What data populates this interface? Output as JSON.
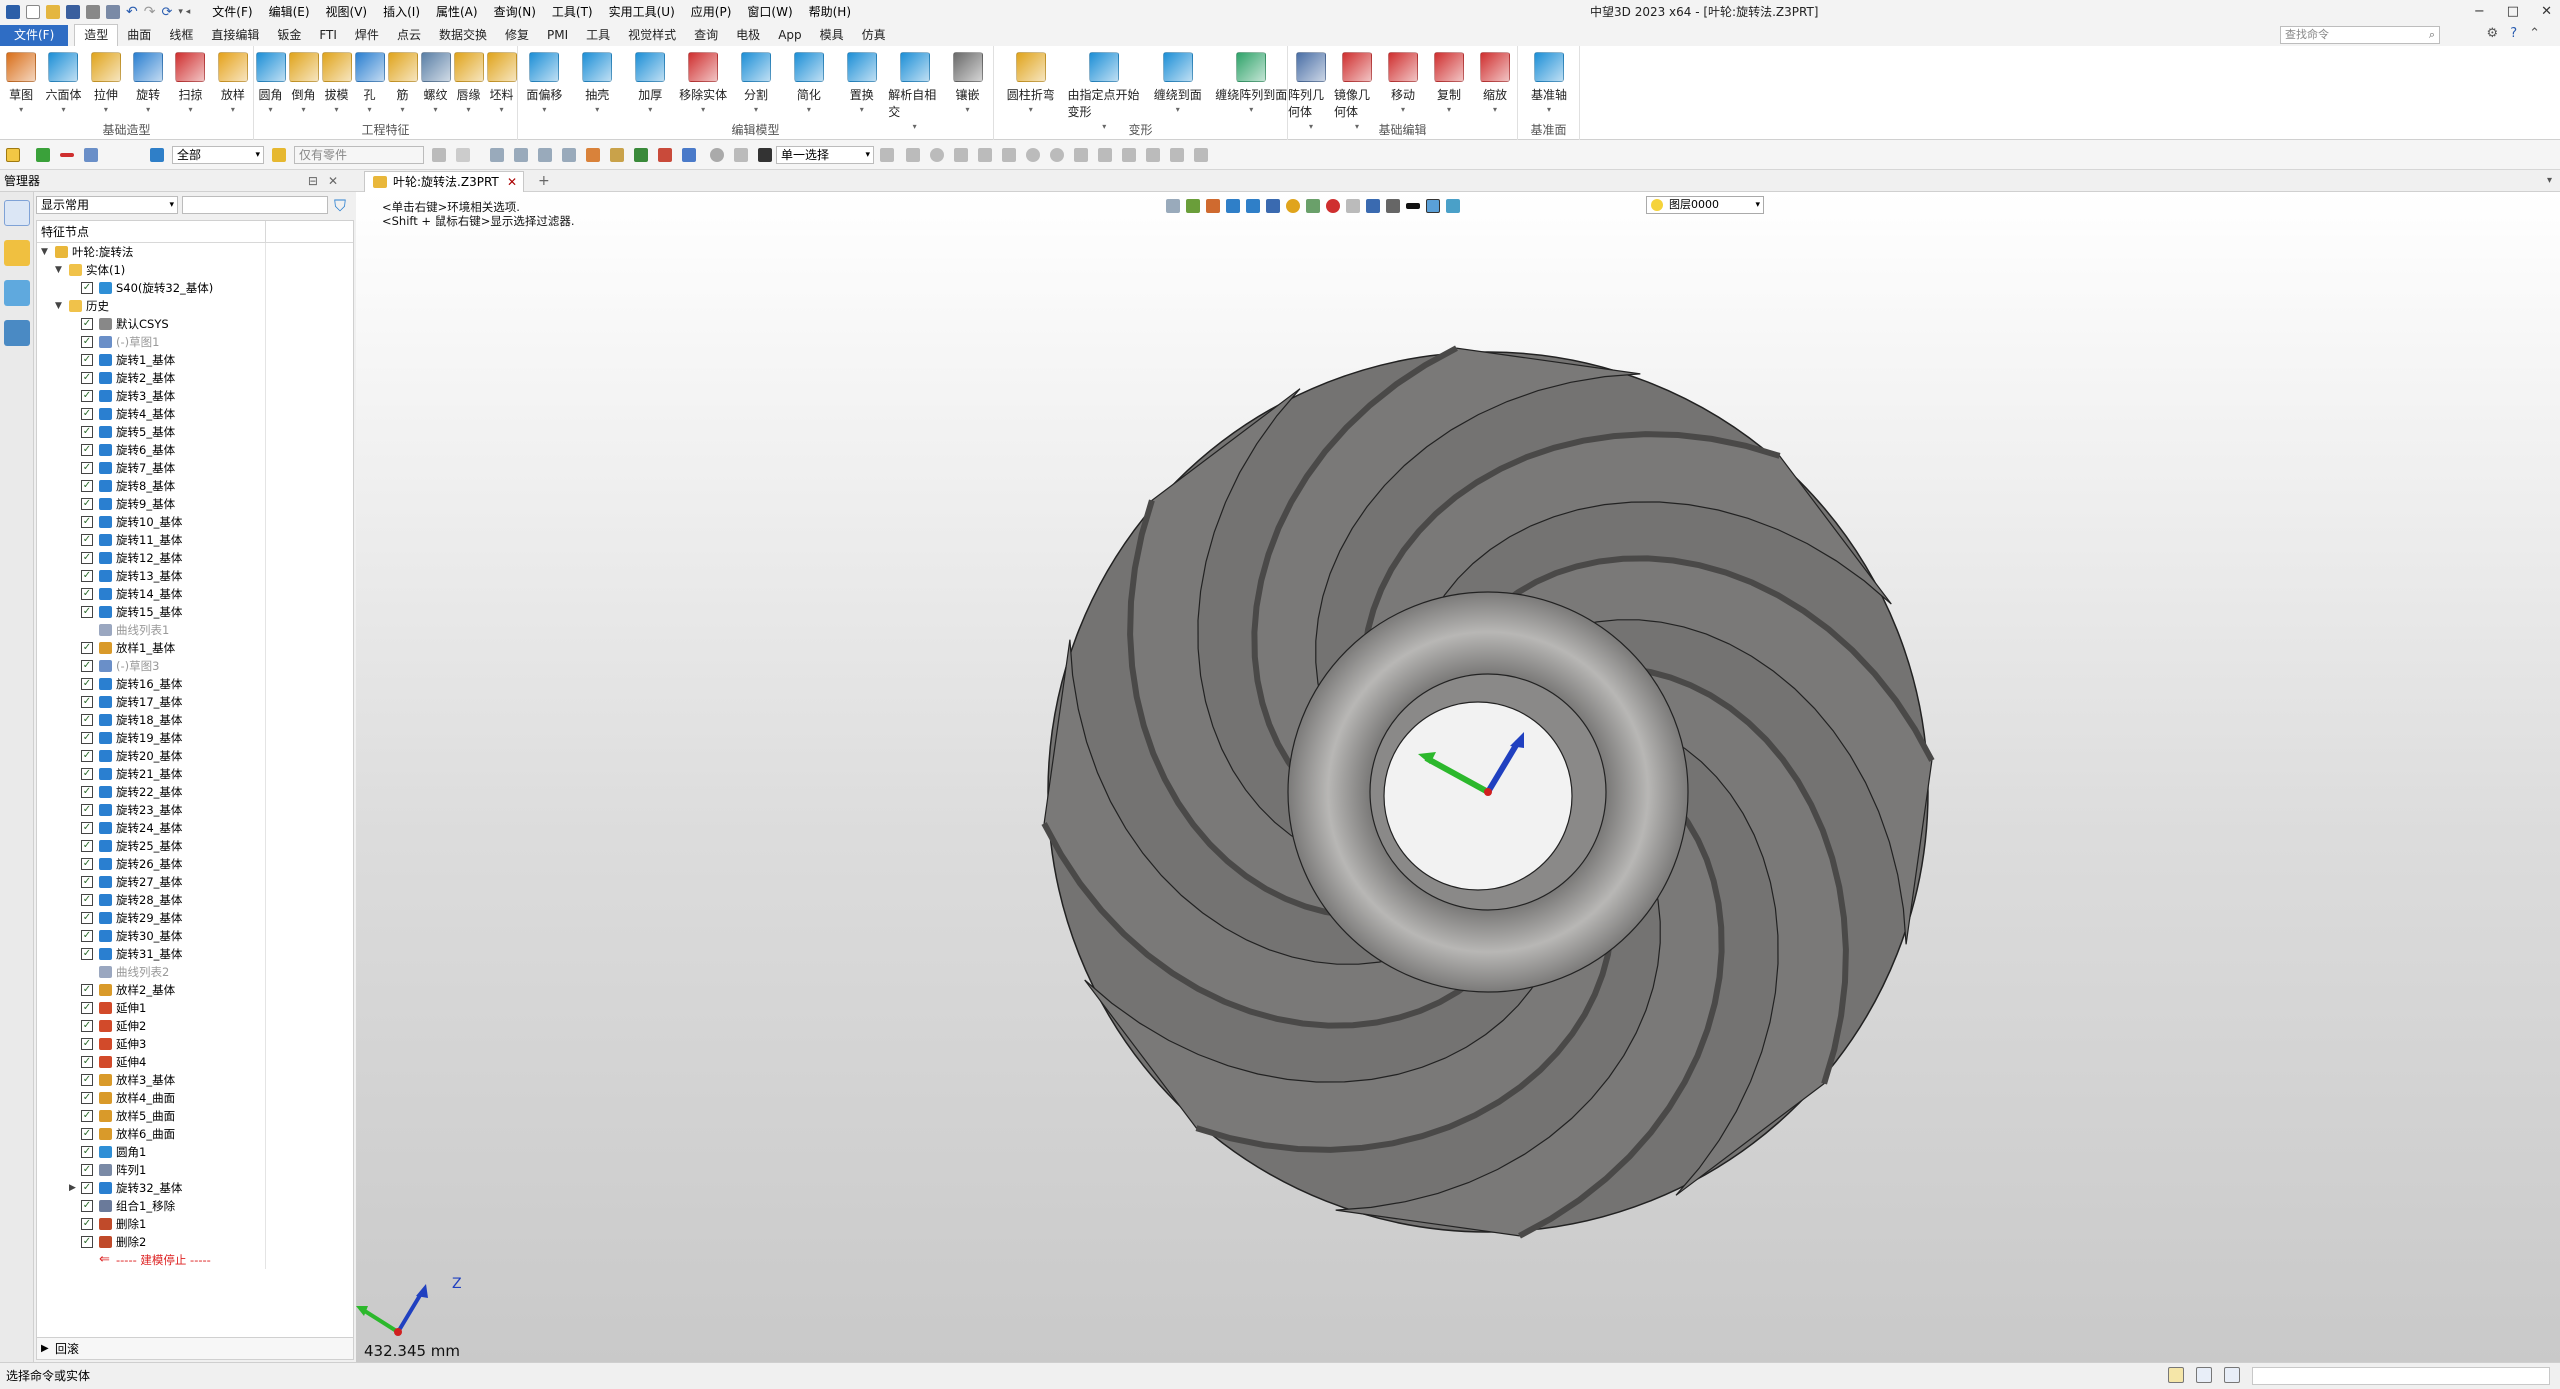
{
  "app": {
    "title": "中望3D 2023 x64 - [叶轮:旋转法.Z3PRT]",
    "menu": [
      "文件(F)",
      "编辑(E)",
      "视图(V)",
      "插入(I)",
      "属性(A)",
      "查询(N)",
      "工具(T)",
      "实用工具(U)",
      "应用(P)",
      "窗口(W)",
      "帮助(H)"
    ],
    "window_controls": [
      "−",
      "□",
      "✕"
    ]
  },
  "ribbon_tabs": [
    "文件(F)",
    "造型",
    "曲面",
    "线框",
    "直接编辑",
    "钣金",
    "FTI",
    "焊件",
    "点云",
    "数据交换",
    "修复",
    "PMI",
    "工具",
    "视觉样式",
    "查询",
    "电极",
    "App",
    "模具",
    "仿真"
  ],
  "search": {
    "placeholder": "查找命令"
  },
  "ribbon_groups": [
    {
      "label": "基础造型",
      "buttons": [
        {
          "label": "草图",
          "icon": "sketch-icon",
          "color": "#d96f1a"
        },
        {
          "label": "六面体",
          "icon": "box-icon",
          "color": "#1d8fd6"
        },
        {
          "label": "拉伸",
          "icon": "extrude-icon",
          "color": "#e0a41c"
        },
        {
          "label": "旋转",
          "icon": "revolve-icon",
          "color": "#2a7fd0"
        },
        {
          "label": "扫掠",
          "icon": "sweep-icon",
          "color": "#cf2f2f"
        },
        {
          "label": "放样",
          "icon": "loft-icon",
          "color": "#e5a21b"
        }
      ]
    },
    {
      "label": "工程特征",
      "buttons": [
        {
          "label": "圆角",
          "icon": "fillet-icon",
          "color": "#1d8fd6"
        },
        {
          "label": "倒角",
          "icon": "chamfer-icon",
          "color": "#e0a41c"
        },
        {
          "label": "拔模",
          "icon": "draft-icon",
          "color": "#e0a41c"
        },
        {
          "label": "孔",
          "icon": "hole-icon",
          "color": "#2a7fd0"
        },
        {
          "label": "筋",
          "icon": "rib-icon",
          "color": "#e0a41c"
        },
        {
          "label": "螺纹",
          "icon": "thread-icon",
          "color": "#5a7fa6"
        },
        {
          "label": "唇缘",
          "icon": "lip-icon",
          "color": "#e0a41c"
        },
        {
          "label": "坯料",
          "icon": "stock-icon",
          "color": "#e0a41c"
        }
      ]
    },
    {
      "label": "编辑模型",
      "buttons": [
        {
          "label": "面偏移",
          "icon": "face-offset-icon",
          "color": "#1d8fd6"
        },
        {
          "label": "抽壳",
          "icon": "shell-icon",
          "color": "#1d8fd6"
        },
        {
          "label": "加厚",
          "icon": "thicken-icon",
          "color": "#1d8fd6"
        },
        {
          "label": "移除实体",
          "icon": "remove-solid-icon",
          "color": "#cf2f2f"
        },
        {
          "label": "分割",
          "icon": "split-icon",
          "color": "#1d8fd6"
        },
        {
          "label": "简化",
          "icon": "simplify-icon",
          "color": "#1d8fd6"
        },
        {
          "label": "置换",
          "icon": "replace-icon",
          "color": "#1d8fd6"
        },
        {
          "label": "解析自相交",
          "icon": "self-intersect-icon",
          "color": "#1d8fd6"
        },
        {
          "label": "镶嵌",
          "icon": "emboss-icon",
          "color": "#6a6a6a"
        }
      ]
    },
    {
      "label": "变形",
      "buttons": [
        {
          "label": "圆柱折弯",
          "icon": "cylinder-bend-icon",
          "color": "#e0a41c"
        },
        {
          "label": "由指定点开始变形",
          "icon": "point-deform-icon",
          "color": "#1d8fd6"
        },
        {
          "label": "缠绕到面",
          "icon": "wrap-face-icon",
          "color": "#1d8fd6"
        },
        {
          "label": "缠绕阵列到面",
          "icon": "wrap-pattern-icon",
          "color": "#2fa36a"
        }
      ]
    },
    {
      "label": "基础编辑",
      "buttons": [
        {
          "label": "阵列几何体",
          "icon": "pattern-icon",
          "color": "#4a6fa6"
        },
        {
          "label": "镜像几何体",
          "icon": "mirror-icon",
          "color": "#cf2f2f"
        },
        {
          "label": "移动",
          "icon": "move-icon",
          "color": "#cf2f2f"
        },
        {
          "label": "复制",
          "icon": "copy-icon",
          "color": "#cf2f2f"
        },
        {
          "label": "缩放",
          "icon": "scale-icon",
          "color": "#cf2f2f"
        }
      ]
    },
    {
      "label": "基准面",
      "buttons": [
        {
          "label": "基准轴",
          "icon": "datum-axis-icon",
          "color": "#1d8fd6"
        }
      ]
    }
  ],
  "toolbar2": {
    "filter_all": "全部",
    "part_only": "仅有零件",
    "select_mode": "单一选择"
  },
  "manager": {
    "title": "管理器",
    "filter_value": "显示常用",
    "column_header": "特征节点",
    "rollback": "回滚"
  },
  "tree": [
    {
      "level": 0,
      "label": "叶轮:旋转法",
      "exp": "v",
      "check": false,
      "icon": "part",
      "state": "normal"
    },
    {
      "level": 1,
      "label": "实体(1)",
      "exp": "v",
      "check": false,
      "icon": "folder",
      "state": "normal"
    },
    {
      "level": 2,
      "label": "S40(旋转32_基体)",
      "exp": "",
      "check": true,
      "icon": "solid",
      "state": "normal"
    },
    {
      "level": 1,
      "label": "历史",
      "exp": "v",
      "check": false,
      "icon": "folder",
      "state": "normal"
    },
    {
      "level": 2,
      "label": "默认CSYS",
      "exp": "",
      "check": true,
      "icon": "csys",
      "state": "normal"
    },
    {
      "level": 2,
      "label": "(-)草图1",
      "exp": "",
      "check": true,
      "icon": "sketch",
      "state": "dim"
    },
    {
      "level": 2,
      "label": "旋转1_基体",
      "exp": "",
      "check": true,
      "icon": "revolve",
      "state": "normal"
    },
    {
      "level": 2,
      "label": "旋转2_基体",
      "exp": "",
      "check": true,
      "icon": "revolve",
      "state": "normal"
    },
    {
      "level": 2,
      "label": "旋转3_基体",
      "exp": "",
      "check": true,
      "icon": "revolve",
      "state": "normal"
    },
    {
      "level": 2,
      "label": "旋转4_基体",
      "exp": "",
      "check": true,
      "icon": "revolve",
      "state": "normal"
    },
    {
      "level": 2,
      "label": "旋转5_基体",
      "exp": "",
      "check": true,
      "icon": "revolve",
      "state": "normal"
    },
    {
      "level": 2,
      "label": "旋转6_基体",
      "exp": "",
      "check": true,
      "icon": "revolve",
      "state": "normal"
    },
    {
      "level": 2,
      "label": "旋转7_基体",
      "exp": "",
      "check": true,
      "icon": "revolve",
      "state": "normal"
    },
    {
      "level": 2,
      "label": "旋转8_基体",
      "exp": "",
      "check": true,
      "icon": "revolve",
      "state": "normal"
    },
    {
      "level": 2,
      "label": "旋转9_基体",
      "exp": "",
      "check": true,
      "icon": "revolve",
      "state": "normal"
    },
    {
      "level": 2,
      "label": "旋转10_基体",
      "exp": "",
      "check": true,
      "icon": "revolve",
      "state": "normal"
    },
    {
      "level": 2,
      "label": "旋转11_基体",
      "exp": "",
      "check": true,
      "icon": "revolve",
      "state": "normal"
    },
    {
      "level": 2,
      "label": "旋转12_基体",
      "exp": "",
      "check": true,
      "icon": "revolve",
      "state": "normal"
    },
    {
      "level": 2,
      "label": "旋转13_基体",
      "exp": "",
      "check": true,
      "icon": "revolve",
      "state": "normal"
    },
    {
      "level": 2,
      "label": "旋转14_基体",
      "exp": "",
      "check": true,
      "icon": "revolve",
      "state": "normal"
    },
    {
      "level": 2,
      "label": "旋转15_基体",
      "exp": "",
      "check": true,
      "icon": "revolve",
      "state": "normal"
    },
    {
      "level": 2,
      "label": "曲线列表1",
      "exp": "",
      "check": false,
      "icon": "curvelist",
      "state": "dim"
    },
    {
      "level": 2,
      "label": "放样1_基体",
      "exp": "",
      "check": true,
      "icon": "loft",
      "state": "normal"
    },
    {
      "level": 2,
      "label": "(-)草图3",
      "exp": "",
      "check": true,
      "icon": "sketch",
      "state": "dim"
    },
    {
      "level": 2,
      "label": "旋转16_基体",
      "exp": "",
      "check": true,
      "icon": "revolve",
      "state": "normal"
    },
    {
      "level": 2,
      "label": "旋转17_基体",
      "exp": "",
      "check": true,
      "icon": "revolve",
      "state": "normal"
    },
    {
      "level": 2,
      "label": "旋转18_基体",
      "exp": "",
      "check": true,
      "icon": "revolve",
      "state": "normal"
    },
    {
      "level": 2,
      "label": "旋转19_基体",
      "exp": "",
      "check": true,
      "icon": "revolve",
      "state": "normal"
    },
    {
      "level": 2,
      "label": "旋转20_基体",
      "exp": "",
      "check": true,
      "icon": "revolve",
      "state": "normal"
    },
    {
      "level": 2,
      "label": "旋转21_基体",
      "exp": "",
      "check": true,
      "icon": "revolve",
      "state": "normal"
    },
    {
      "level": 2,
      "label": "旋转22_基体",
      "exp": "",
      "check": true,
      "icon": "revolve",
      "state": "normal"
    },
    {
      "level": 2,
      "label": "旋转23_基体",
      "exp": "",
      "check": true,
      "icon": "revolve",
      "state": "normal"
    },
    {
      "level": 2,
      "label": "旋转24_基体",
      "exp": "",
      "check": true,
      "icon": "revolve",
      "state": "normal"
    },
    {
      "level": 2,
      "label": "旋转25_基体",
      "exp": "",
      "check": true,
      "icon": "revolve",
      "state": "normal"
    },
    {
      "level": 2,
      "label": "旋转26_基体",
      "exp": "",
      "check": true,
      "icon": "revolve",
      "state": "normal"
    },
    {
      "level": 2,
      "label": "旋转27_基体",
      "exp": "",
      "check": true,
      "icon": "revolve",
      "state": "normal"
    },
    {
      "level": 2,
      "label": "旋转28_基体",
      "exp": "",
      "check": true,
      "icon": "revolve",
      "state": "normal"
    },
    {
      "level": 2,
      "label": "旋转29_基体",
      "exp": "",
      "check": true,
      "icon": "revolve",
      "state": "normal"
    },
    {
      "level": 2,
      "label": "旋转30_基体",
      "exp": "",
      "check": true,
      "icon": "revolve",
      "state": "normal"
    },
    {
      "level": 2,
      "label": "旋转31_基体",
      "exp": "",
      "check": true,
      "icon": "revolve",
      "state": "normal"
    },
    {
      "level": 2,
      "label": "曲线列表2",
      "exp": "",
      "check": false,
      "icon": "curvelist",
      "state": "dim"
    },
    {
      "level": 2,
      "label": "放样2_基体",
      "exp": "",
      "check": true,
      "icon": "loft",
      "state": "normal"
    },
    {
      "level": 2,
      "label": "延伸1",
      "exp": "",
      "check": true,
      "icon": "extend",
      "state": "normal"
    },
    {
      "level": 2,
      "label": "延伸2",
      "exp": "",
      "check": true,
      "icon": "extend",
      "state": "normal"
    },
    {
      "level": 2,
      "label": "延伸3",
      "exp": "",
      "check": true,
      "icon": "extend",
      "state": "normal"
    },
    {
      "level": 2,
      "label": "延伸4",
      "exp": "",
      "check": true,
      "icon": "extend",
      "state": "normal"
    },
    {
      "level": 2,
      "label": "放样3_基体",
      "exp": "",
      "check": true,
      "icon": "loft",
      "state": "normal"
    },
    {
      "level": 2,
      "label": "放样4_曲面",
      "exp": "",
      "check": true,
      "icon": "loft",
      "state": "normal"
    },
    {
      "level": 2,
      "label": "放样5_曲面",
      "exp": "",
      "check": true,
      "icon": "loft",
      "state": "normal"
    },
    {
      "level": 2,
      "label": "放样6_曲面",
      "exp": "",
      "check": true,
      "icon": "loft",
      "state": "normal"
    },
    {
      "level": 2,
      "label": "圆角1",
      "exp": "",
      "check": true,
      "icon": "fillet",
      "state": "normal"
    },
    {
      "level": 2,
      "label": "阵列1",
      "exp": "",
      "check": true,
      "icon": "pattern",
      "state": "normal"
    },
    {
      "level": 2,
      "label": "旋转32_基体",
      "exp": ">",
      "check": true,
      "icon": "revolve",
      "state": "normal"
    },
    {
      "level": 2,
      "label": "组合1_移除",
      "exp": "",
      "check": true,
      "icon": "combine",
      "state": "normal"
    },
    {
      "level": 2,
      "label": "删除1",
      "exp": "",
      "check": true,
      "icon": "delete",
      "state": "normal"
    },
    {
      "level": 2,
      "label": "删除2",
      "exp": "",
      "check": true,
      "icon": "delete",
      "state": "normal"
    },
    {
      "level": 2,
      "label": "----- 建模停止 -----",
      "exp": "",
      "check": false,
      "icon": "stop",
      "state": "stop"
    }
  ],
  "document_tab": {
    "name": "叶轮:旋转法.Z3PRT"
  },
  "viewport": {
    "hint_lines": [
      "<单击右键>环境相关选项.",
      "<Shift + 鼠标右键>显示选择过滤器."
    ],
    "layer": "图层0000",
    "scale_label": "432.345 mm",
    "axis_z": "Z",
    "colors": {
      "blade_face": "#7a7978",
      "blade_dark": "#4a4948",
      "hub": "#8d8c8b",
      "edge": "#222222"
    },
    "blade_count": 8
  },
  "status": {
    "text": "选择命令或实体"
  }
}
